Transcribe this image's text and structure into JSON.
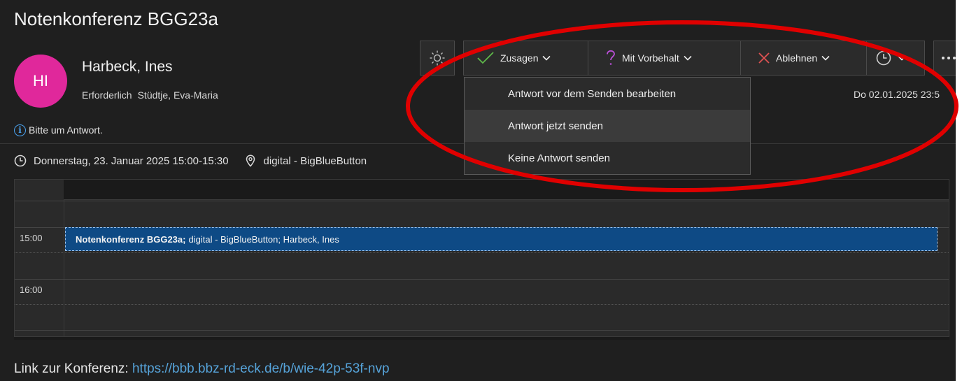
{
  "meeting": {
    "title": "Notenkonferenz BGG23a",
    "organizer_initials": "HI",
    "organizer_name": "Harbeck, Ines",
    "required_label": "Erforderlich",
    "required_attendee": "Stüdtje, Eva-Maria",
    "info_message": "Bitte um Antwort.",
    "datetime": "Donnerstag, 23. Januar 2025 15:00-15:30",
    "location": "digital - BigBlueButton",
    "sent_date": "Do 02.01.2025 23:5"
  },
  "toolbar": {
    "accept_label": "Zusagen",
    "tentative_label": "Mit Vorbehalt",
    "decline_label": "Ablehnen"
  },
  "dropdown": {
    "items": [
      {
        "label": "Antwort vor dem Senden bearbeiten"
      },
      {
        "label": "Antwort jetzt senden"
      },
      {
        "label": "Keine Antwort senden"
      }
    ]
  },
  "calendar": {
    "hours": [
      "15:00",
      "16:00"
    ],
    "event_title": "Notenkonferenz BGG23a;",
    "event_details": "digital - BigBlueButton; Harbeck, Ines"
  },
  "body": {
    "link_label": "Link zur Konferenz:",
    "link_url": "https://bbb.bbz-rd-eck.de/b/wie-42p-53f-nvp"
  },
  "colors": {
    "avatar": "#e0289b",
    "accept": "#5fb84a",
    "tentative": "#b94fd6",
    "decline": "#e05252",
    "event": "#0e4a85",
    "annotation": "#e00000",
    "link": "#56a3d9"
  }
}
